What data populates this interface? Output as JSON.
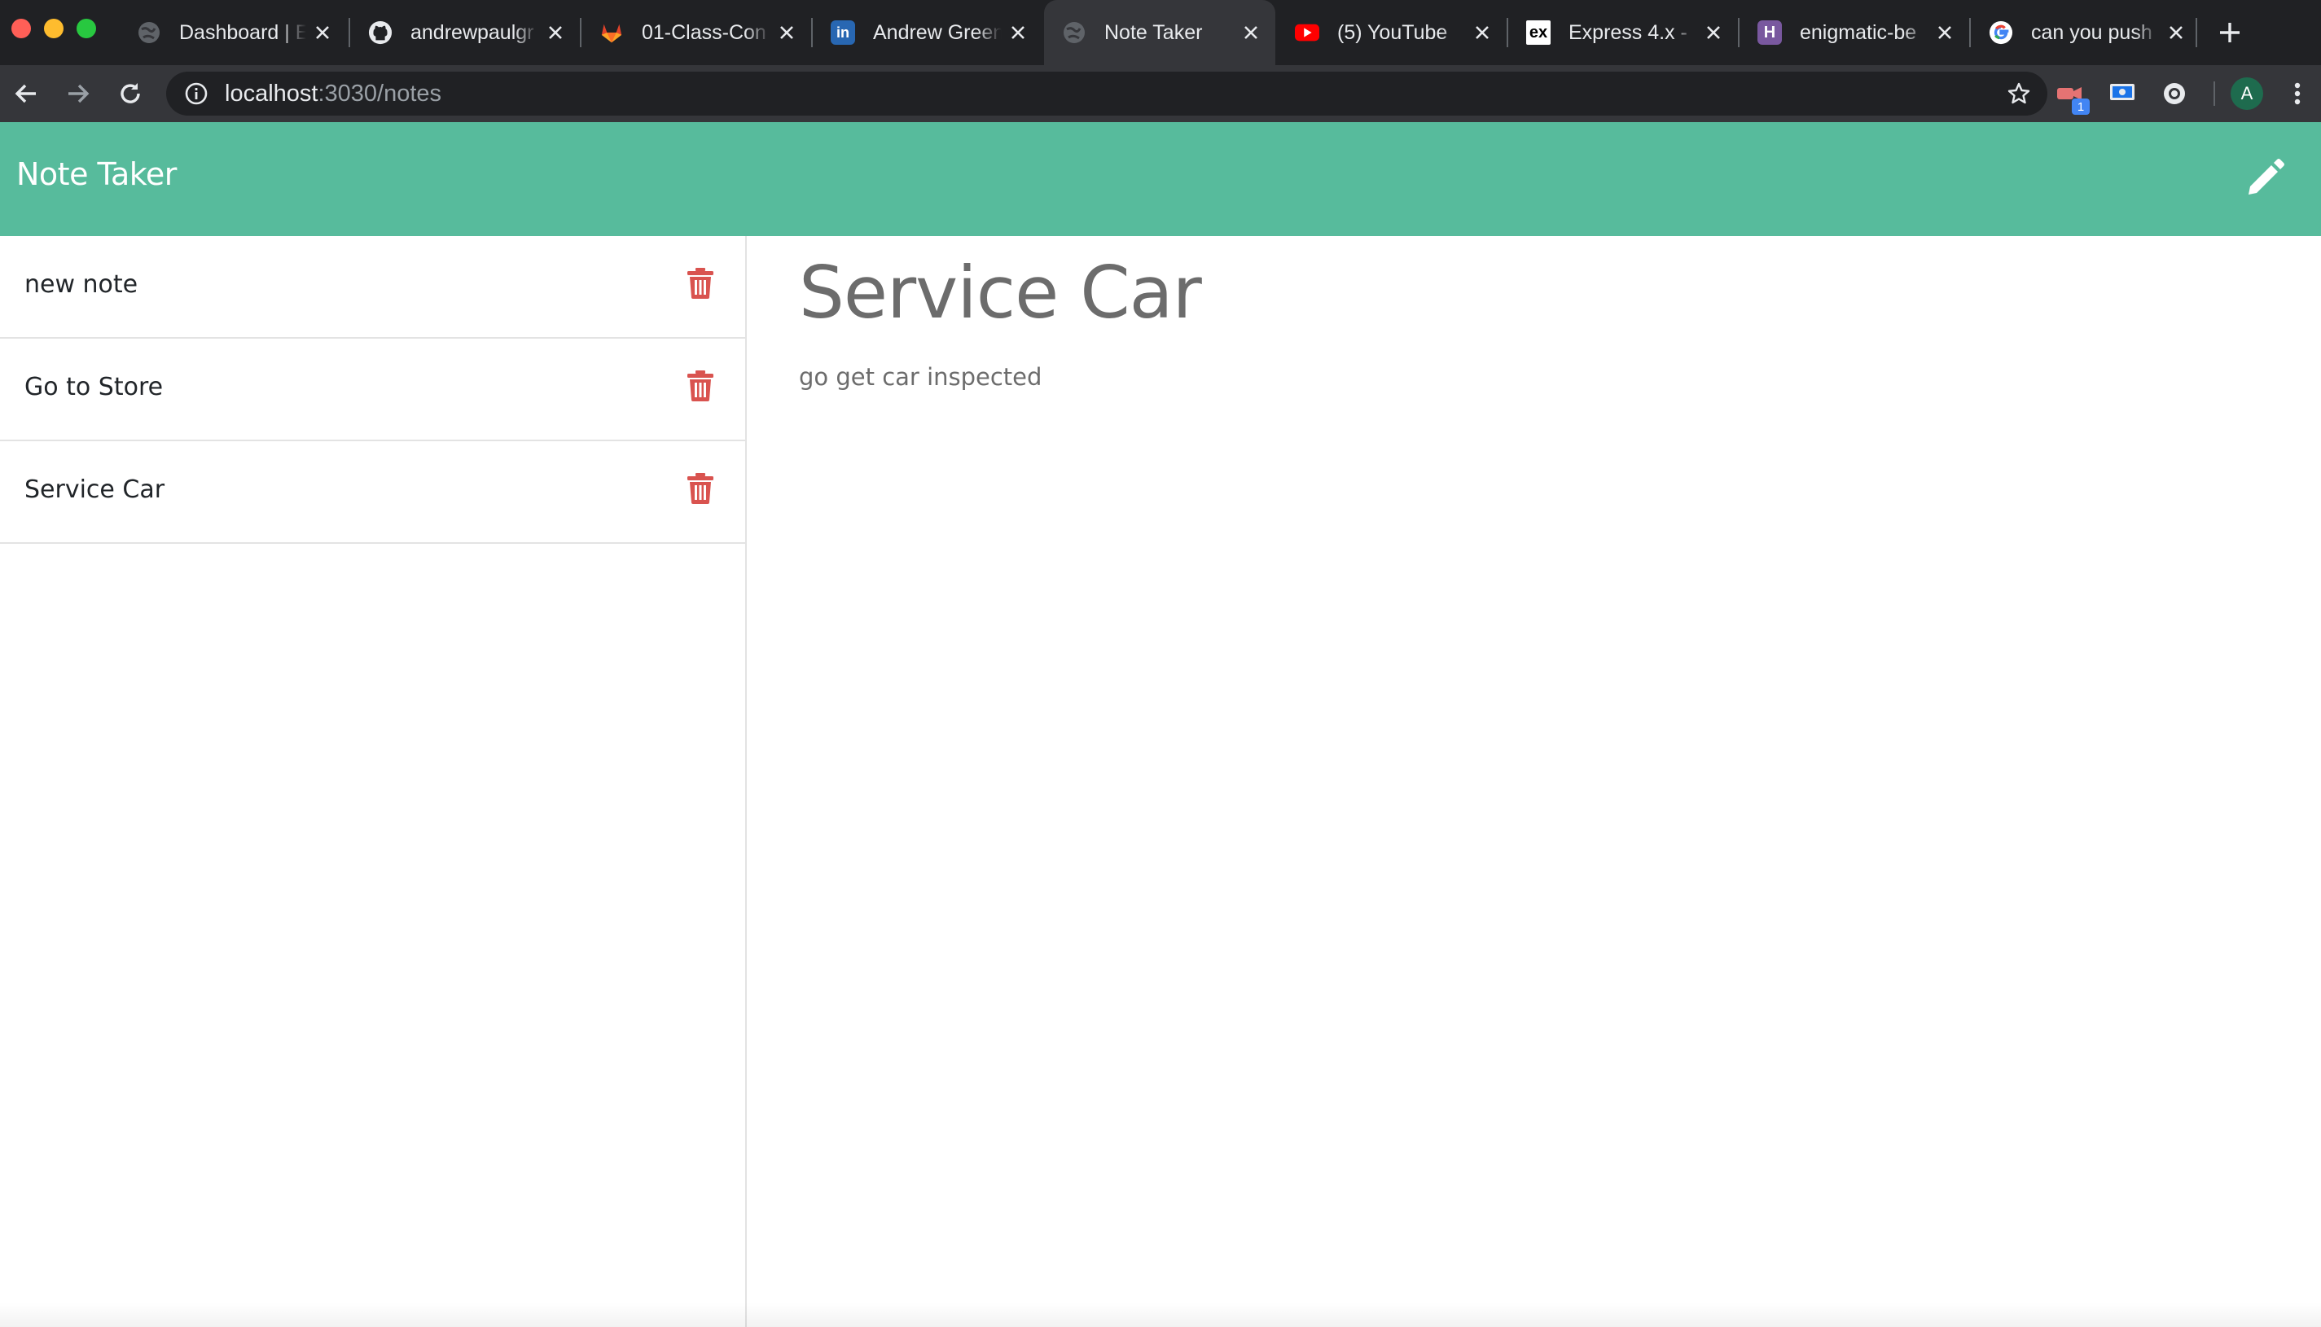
{
  "browser": {
    "tabs": [
      {
        "title": "Dashboard | E",
        "icon": "globe-icon",
        "active": false
      },
      {
        "title": "andrewpaulgr",
        "icon": "github-icon",
        "active": false
      },
      {
        "title": "01-Class-Con",
        "icon": "gitlab-icon",
        "active": false
      },
      {
        "title": "Andrew Green",
        "icon": "linkedin-icon",
        "active": false
      },
      {
        "title": "Note Taker",
        "icon": "globe-icon",
        "active": true
      },
      {
        "title": "(5) YouTube",
        "icon": "youtube-icon",
        "active": false
      },
      {
        "title": "Express 4.x -",
        "icon": "express-icon",
        "active": false
      },
      {
        "title": "enigmatic-be",
        "icon": "heroku-icon",
        "active": false
      },
      {
        "title": "can you push",
        "icon": "google-icon",
        "active": false
      }
    ],
    "url_host": "localhost",
    "url_rest": ":3030/notes",
    "extension_badge": "1",
    "avatar_letter": "A"
  },
  "app": {
    "title": "Note Taker",
    "notes": [
      {
        "title": "new note"
      },
      {
        "title": "Go to Store"
      },
      {
        "title": "Service Car"
      }
    ],
    "active_note": {
      "title": "Service Car",
      "text": "go get car inspected"
    }
  },
  "colors": {
    "navbar": "#57bb9c",
    "delete": "#d9534f",
    "chrome_dark": "#202124",
    "chrome_toolbar": "#35363a"
  }
}
